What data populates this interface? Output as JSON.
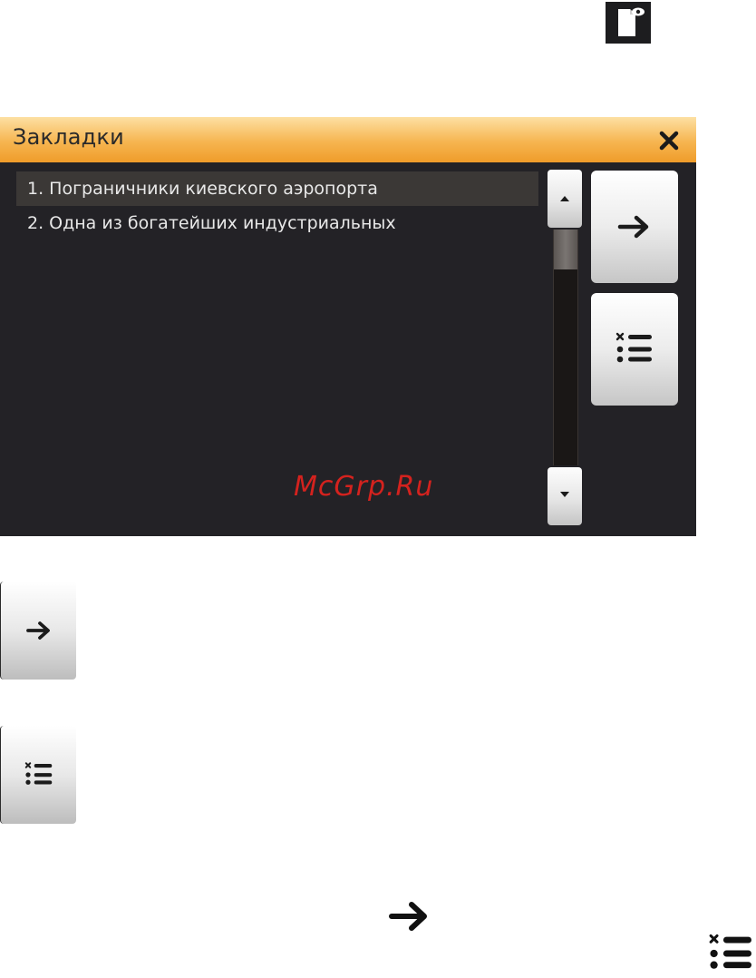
{
  "dialog": {
    "title": "Закладки",
    "bookmarks": [
      {
        "label": "1. Пограничники киевского аэропорта",
        "selected": true
      },
      {
        "label": "2. Одна из богатейших индустриальных",
        "selected": false
      }
    ],
    "scroll_position": 0.0,
    "scroll_visible_fraction": 0.17
  },
  "watermark": "McGrp.Ru",
  "icons": {
    "top": "document-preview-icon",
    "close": "close-icon",
    "go": "arrow-right-icon",
    "clear": "clear-list-icon",
    "scroll_up": "scroll-up-icon",
    "scroll_down": "scroll-down-icon"
  },
  "colors": {
    "header_accent": "#f6b550",
    "dialog_bg": "#232226",
    "watermark": "#d4221e"
  }
}
